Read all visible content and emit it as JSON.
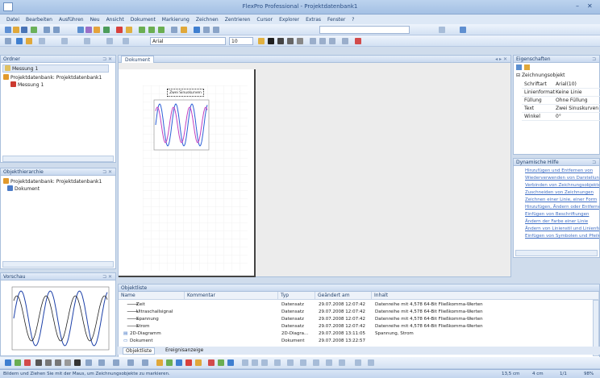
{
  "window": {
    "title": "FlexPro Professional - Projektdatenbank1"
  },
  "menu": [
    "Datei",
    "Bearbeiten",
    "Ausführen",
    "Neu",
    "Ansicht",
    "Dokument",
    "Markierung",
    "Zeichnen",
    "Zentrieren",
    "Cursor",
    "Explorer",
    "Extras",
    "Fenster",
    "?"
  ],
  "toolbar": {
    "font": "Arial",
    "size": "10"
  },
  "folder_panel": {
    "title": "Ordner",
    "items": [
      "Messung 1",
      "Projektdatenbank: Projektdatenbank1",
      "Messung 1"
    ]
  },
  "hierarchy_panel": {
    "title": "Objekthierarchie",
    "items": [
      "Projektdatenbank: Projektdatenbank1",
      "Dokument"
    ]
  },
  "preview_panel": {
    "title": "Vorschau"
  },
  "document": {
    "tab": "Dokument",
    "chart_label": "Zwei Sinuskurven"
  },
  "properties": {
    "title": "Eigenschaften",
    "group": "Zeichnungsobjekt",
    "rows": [
      {
        "key": "Schriftart",
        "value": "Arial(10)"
      },
      {
        "key": "Linienformat",
        "value": "Keine Linie"
      },
      {
        "key": "Füllung",
        "value": "Ohne Füllung"
      },
      {
        "key": "Text",
        "value": "Zwei Sinuskurven"
      },
      {
        "key": "Winkel",
        "value": "0°"
      }
    ]
  },
  "help": {
    "title": "Dynamische Hilfe",
    "links": [
      "Hinzufügen und Entfernen von",
      "Wiederverwenden von Darstellungen",
      "Verbinden von Zeichnungsobjekten",
      "Zuschneiden von Zeichnungen",
      "Zeichnen einer Linie, einer Form",
      "Hinzufügen, Ändern oder Entfernen",
      "Einfügen von Beschriftungen",
      "Ändern der Farbe einer Linie",
      "Ändern von Linienstil und Linienfarbe",
      "Einfügen von Symbolen und Pfeilen"
    ]
  },
  "object_list": {
    "title": "Objektliste",
    "columns": [
      "Name",
      "Kommentar",
      "Typ",
      "Geändert am",
      "Inhalt"
    ],
    "rows": [
      {
        "name": "Zeit",
        "comment": "",
        "type": "Datensatz",
        "changed": "29.07.2008 12:07:42",
        "content": "Datenreihe mit 4,578 64-Bit Fließkomma-Werten"
      },
      {
        "name": "Ultraschallsignal",
        "comment": "",
        "type": "Datensatz",
        "changed": "29.07.2008 12:07:42",
        "content": "Datenreihe mit 4,578 64-Bit Fließkomma-Werten"
      },
      {
        "name": "Spannung",
        "comment": "",
        "type": "Datensatz",
        "changed": "29.07.2008 12:07:42",
        "content": "Datenreihe mit 4,578 64-Bit Fließkomma-Werten"
      },
      {
        "name": "Strom",
        "comment": "",
        "type": "Datensatz",
        "changed": "29.07.2008 12:07:42",
        "content": "Datenreihe mit 4,578 64-Bit Fließkomma-Werten"
      },
      {
        "name": "2D-Diagramm",
        "comment": "",
        "type": "2D-Diagra...",
        "changed": "29.07.2008 13:11:05",
        "content": "Spannung, Strom"
      },
      {
        "name": "Dokument",
        "comment": "",
        "type": "Dokument",
        "changed": "29.07.2008 13:22:57",
        "content": ""
      }
    ],
    "tabs": [
      "Objektliste",
      "Ereignisanzeige"
    ]
  },
  "status": {
    "message": "Bildern und Ziehen Sie mit der Maus, um Zeichnungsobjekte zu markieren.",
    "pos1": "13,5 cm",
    "pos2": "4 cm",
    "page": "1/1",
    "zoom": "98%"
  }
}
